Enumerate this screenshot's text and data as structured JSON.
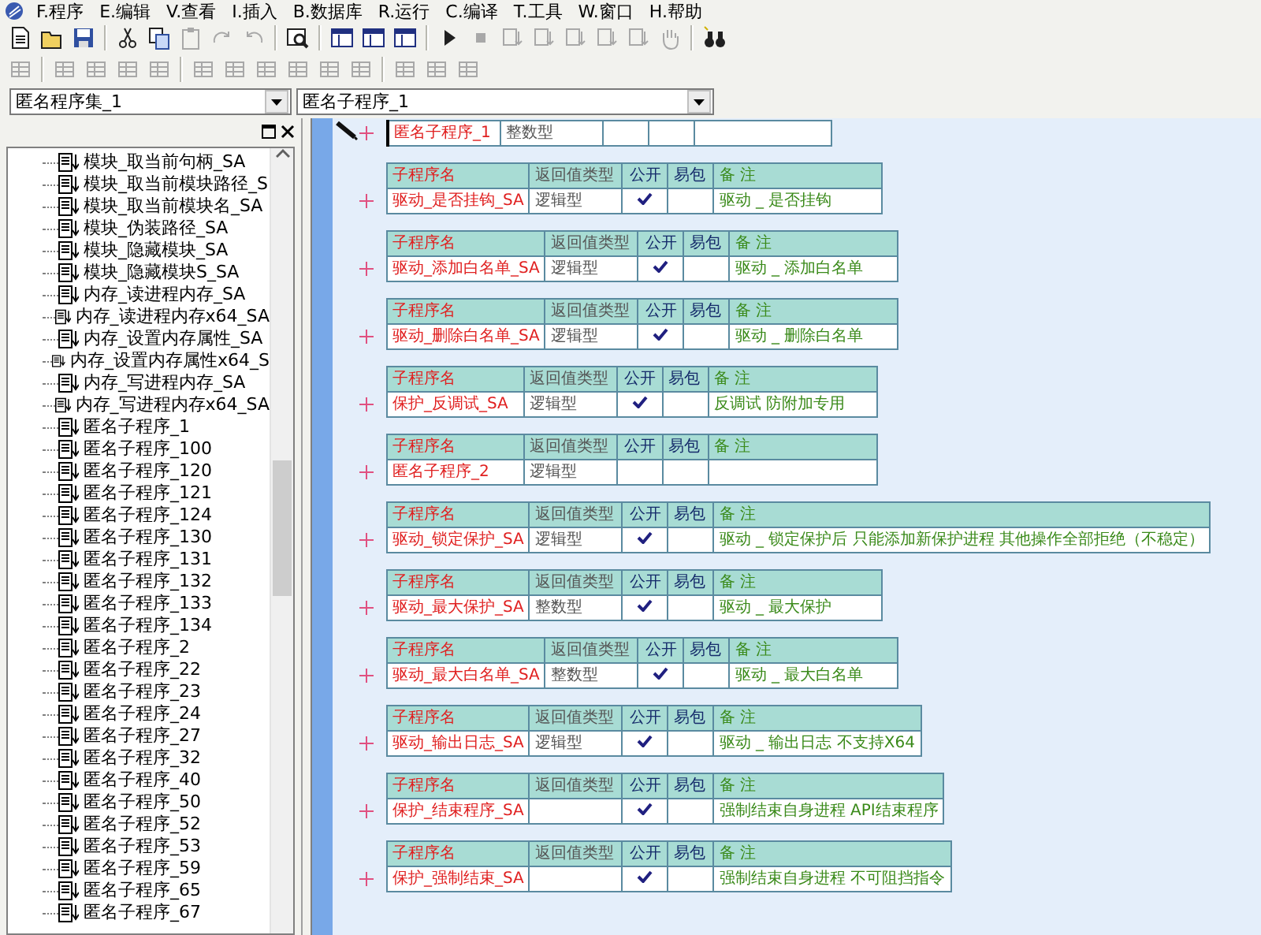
{
  "menu": [
    {
      "label": "F.程序"
    },
    {
      "label": "E.编辑"
    },
    {
      "label": "V.查看"
    },
    {
      "label": "I.插入"
    },
    {
      "label": "B.数据库"
    },
    {
      "label": "R.运行"
    },
    {
      "label": "C.编译"
    },
    {
      "label": "T.工具"
    },
    {
      "label": "W.窗口"
    },
    {
      "label": "H.帮助"
    }
  ],
  "toolbars": [
    [
      {
        "kind": "button",
        "disabled": false
      },
      {
        "kind": "button",
        "disabled": false
      },
      {
        "kind": "button",
        "disabled": false
      },
      {
        "kind": "separator"
      },
      {
        "kind": "button",
        "disabled": false
      },
      {
        "kind": "button",
        "disabled": false
      },
      {
        "kind": "button",
        "disabled": true
      },
      {
        "kind": "button",
        "disabled": true
      },
      {
        "kind": "button",
        "disabled": true
      },
      {
        "kind": "separator"
      },
      {
        "kind": "button",
        "disabled": false
      },
      {
        "kind": "separator"
      },
      {
        "kind": "button",
        "disabled": false
      },
      {
        "kind": "button",
        "disabled": false
      },
      {
        "kind": "button",
        "disabled": false
      },
      {
        "kind": "separator"
      },
      {
        "kind": "button",
        "disabled": false
      },
      {
        "kind": "button",
        "disabled": true
      },
      {
        "kind": "button",
        "disabled": true
      },
      {
        "kind": "button",
        "disabled": true
      },
      {
        "kind": "button",
        "disabled": true
      },
      {
        "kind": "button",
        "disabled": true
      },
      {
        "kind": "button",
        "disabled": true
      },
      {
        "kind": "button",
        "disabled": true
      },
      {
        "kind": "separator"
      },
      {
        "kind": "button",
        "disabled": false
      }
    ],
    [
      {
        "kind": "button",
        "disabled": true
      },
      {
        "kind": "separator"
      },
      {
        "kind": "button",
        "disabled": true
      },
      {
        "kind": "button",
        "disabled": true
      },
      {
        "kind": "button",
        "disabled": true
      },
      {
        "kind": "button",
        "disabled": true
      },
      {
        "kind": "separator"
      },
      {
        "kind": "button",
        "disabled": true
      },
      {
        "kind": "button",
        "disabled": true
      },
      {
        "kind": "button",
        "disabled": true
      },
      {
        "kind": "button",
        "disabled": true
      },
      {
        "kind": "button",
        "disabled": true
      },
      {
        "kind": "button",
        "disabled": true
      },
      {
        "kind": "separator"
      },
      {
        "kind": "button",
        "disabled": true
      },
      {
        "kind": "button",
        "disabled": true
      },
      {
        "kind": "button",
        "disabled": true
      }
    ]
  ],
  "selectors": [
    {
      "value": "匿名程序集_1"
    },
    {
      "value": "匿名子程序_1"
    }
  ],
  "tree": {
    "items": [
      {
        "label": "模块_取当前句柄_SA"
      },
      {
        "label": "模块_取当前模块路径_S"
      },
      {
        "label": "模块_取当前模块名_SA"
      },
      {
        "label": "模块_伪装路径_SA"
      },
      {
        "label": "模块_隐藏模块_SA"
      },
      {
        "label": "模块_隐藏模块S_SA"
      },
      {
        "label": "内存_读进程内存_SA"
      },
      {
        "label": "内存_读进程内存x64_SA"
      },
      {
        "label": "内存_设置内存属性_SA"
      },
      {
        "label": "内存_设置内存属性x64_S"
      },
      {
        "label": "内存_写进程内存_SA"
      },
      {
        "label": "内存_写进程内存x64_SA"
      },
      {
        "label": "匿名子程序_1"
      },
      {
        "label": "匿名子程序_100"
      },
      {
        "label": "匿名子程序_120"
      },
      {
        "label": "匿名子程序_121"
      },
      {
        "label": "匿名子程序_124"
      },
      {
        "label": "匿名子程序_130"
      },
      {
        "label": "匿名子程序_131"
      },
      {
        "label": "匿名子程序_132"
      },
      {
        "label": "匿名子程序_133"
      },
      {
        "label": "匿名子程序_134"
      },
      {
        "label": "匿名子程序_2"
      },
      {
        "label": "匿名子程序_22"
      },
      {
        "label": "匿名子程序_23"
      },
      {
        "label": "匿名子程序_24"
      },
      {
        "label": "匿名子程序_27"
      },
      {
        "label": "匿名子程序_32"
      },
      {
        "label": "匿名子程序_40"
      },
      {
        "label": "匿名子程序_50"
      },
      {
        "label": "匿名子程序_52"
      },
      {
        "label": "匿名子程序_53"
      },
      {
        "label": "匿名子程序_59"
      },
      {
        "label": "匿名子程序_65"
      },
      {
        "label": "匿名子程序_67"
      }
    ]
  },
  "editor": {
    "current": {
      "name": "匿名子程序_1",
      "type": "整数型",
      "public": false
    },
    "subroutines": [
      {
        "columns": [
          "子程序名",
          "返回值类型",
          "公开",
          "易包",
          "备 注"
        ],
        "name": "驱动_是否挂钩_SA",
        "type": "逻辑型",
        "public": true,
        "remark": "驱动 _ 是否挂钩"
      },
      {
        "columns": [
          "子程序名",
          "返回值类型",
          "公开",
          "易包",
          "备 注"
        ],
        "name": "驱动_添加白名单_SA",
        "type": "逻辑型",
        "public": true,
        "remark": "驱动 _ 添加白名单"
      },
      {
        "columns": [
          "子程序名",
          "返回值类型",
          "公开",
          "易包",
          "备 注"
        ],
        "name": "驱动_删除白名单_SA",
        "type": "逻辑型",
        "public": true,
        "remark": "驱动 _ 删除白名单"
      },
      {
        "columns": [
          "子程序名",
          "返回值类型",
          "公开",
          "易包",
          "备 注"
        ],
        "name": "保护_反调试_SA",
        "type": "逻辑型",
        "public": true,
        "remark": "反调试 防附加专用"
      },
      {
        "columns": [
          "子程序名",
          "返回值类型",
          "公开",
          "易包",
          "备 注"
        ],
        "name": "匿名子程序_2",
        "type": "逻辑型",
        "public": false
      },
      {
        "columns": [
          "子程序名",
          "返回值类型",
          "公开",
          "易包",
          "备 注"
        ],
        "name": "驱动_锁定保护_SA",
        "type": "逻辑型",
        "public": true,
        "remark": "驱动 _ 锁定保护后 只能添加新保护进程 其他操作全部拒绝（不稳定）"
      },
      {
        "columns": [
          "子程序名",
          "返回值类型",
          "公开",
          "易包",
          "备 注"
        ],
        "name": "驱动_最大保护_SA",
        "type": "整数型",
        "public": true,
        "remark": "驱动 _ 最大保护"
      },
      {
        "columns": [
          "子程序名",
          "返回值类型",
          "公开",
          "易包",
          "备 注"
        ],
        "name": "驱动_最大白名单_SA",
        "type": "整数型",
        "public": true,
        "remark": "驱动 _ 最大白名单"
      },
      {
        "columns": [
          "子程序名",
          "返回值类型",
          "公开",
          "易包",
          "备 注"
        ],
        "name": "驱动_输出日志_SA",
        "type": "逻辑型",
        "public": true,
        "remark": "驱动 _ 输出日志 不支持X64"
      },
      {
        "columns": [
          "子程序名",
          "返回值类型",
          "公开",
          "易包",
          "备 注"
        ],
        "name": "保护_结束程序_SA",
        "public": true,
        "remark": "强制结束自身进程 API结束程序"
      },
      {
        "columns": [
          "子程序名",
          "返回值类型",
          "公开",
          "易包",
          "备 注"
        ],
        "name": "保护_强制结束_SA",
        "public": true,
        "remark": "强制结束自身进程 不可阻挡指令"
      }
    ]
  }
}
